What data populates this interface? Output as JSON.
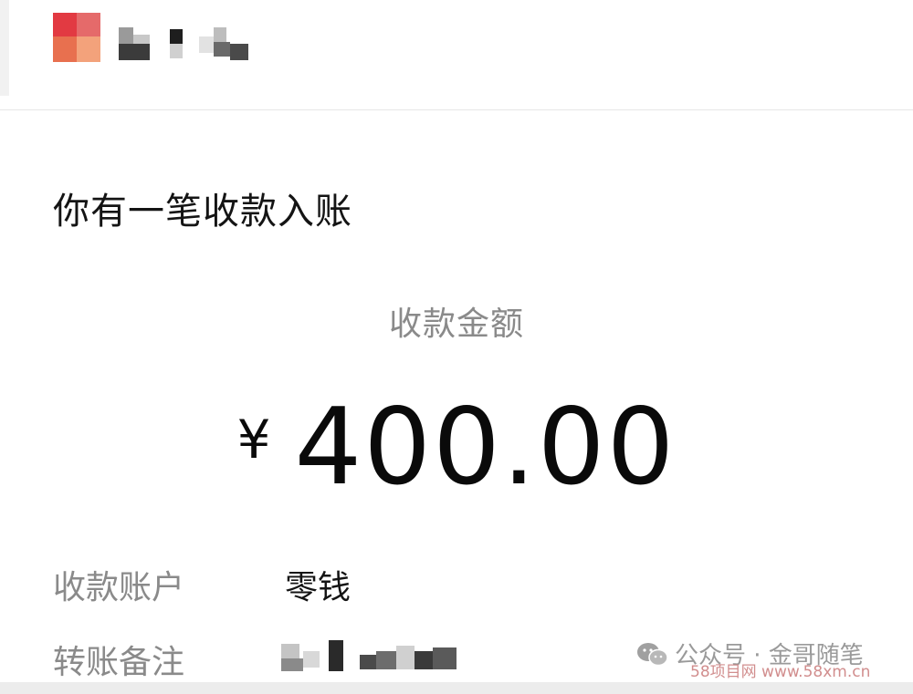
{
  "header": {
    "avatar_icon": "pixelated-avatar-icon",
    "sender_name": "",
    "colors": {
      "avatar_red": "#e03a3f",
      "avatar_orange": "#f08a5a"
    }
  },
  "card": {
    "title": "你有一笔收款入账",
    "amount_label": "收款金额",
    "currency": "¥",
    "amount": "400.00",
    "rows": [
      {
        "label": "收款账户",
        "value": "零钱"
      },
      {
        "label": "转账备注",
        "value": ""
      }
    ]
  },
  "watermark": {
    "icon": "wechat-icon",
    "text": "公众号 · 金哥随笔",
    "site": "58项目网 www.58xm.cn"
  }
}
